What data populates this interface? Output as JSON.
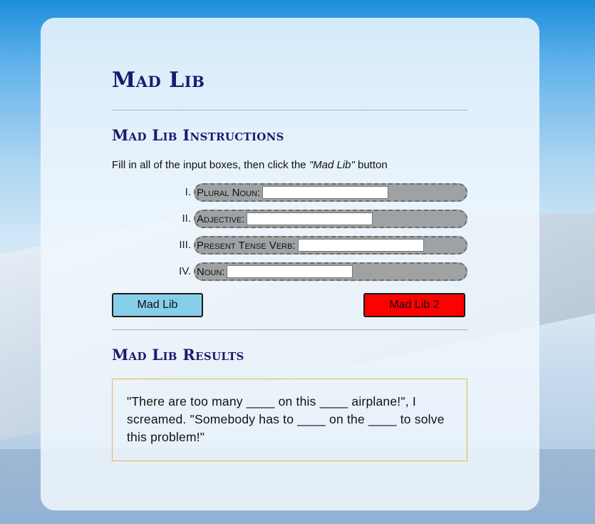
{
  "page": {
    "title": "Mad Lib",
    "instructions_heading": "Mad Lib Instructions",
    "instructions_prefix": "Fill in all of the input boxes, then click the ",
    "instructions_emphasis": "\"Mad Lib\"",
    "instructions_suffix": " button",
    "results_heading": "Mad Lib Results"
  },
  "fields": [
    {
      "number": "I.",
      "label": "Plural Noun:",
      "value": ""
    },
    {
      "number": "II.",
      "label": "Adjective:",
      "value": ""
    },
    {
      "number": "III.",
      "label": "Present Tense Verb:",
      "value": ""
    },
    {
      "number": "IV.",
      "label": "Noun:",
      "value": ""
    }
  ],
  "buttons": {
    "mad_lib": "Mad Lib",
    "mad_lib_2": "Mad Lib 2"
  },
  "results": {
    "text": "\"There are too many ____ on this ____ airplane!\", I screamed. \"Somebody has to ____ on the ____ to solve this problem!\""
  },
  "colors": {
    "heading": "#1a1a6e",
    "mad_lib_button": "#87ceeb",
    "mad_lib_2_button": "#ff0000",
    "field_pill": "#9ea2a5",
    "results_border": "#e0b84a"
  }
}
